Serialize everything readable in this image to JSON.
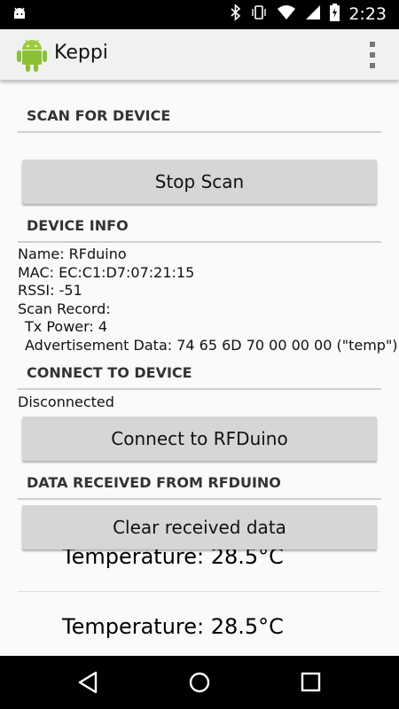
{
  "status_bar": {
    "time": "2:23"
  },
  "app": {
    "title": "Keppi"
  },
  "sections": {
    "scan_header": "SCAN FOR DEVICE",
    "device_info_header": "DEVICE INFO",
    "connect_header": "CONNECT TO DEVICE",
    "data_header": "DATA RECEIVED FROM RFDUINO"
  },
  "buttons": {
    "scan": "Stop Scan",
    "connect": "Connect to RFDuino",
    "clear": "Clear received data"
  },
  "device_info": {
    "name": "Name: RFduino",
    "mac": "MAC: EC:C1:D7:07:21:15",
    "rssi": "RSSI: -51",
    "scan_record": "Scan Record:",
    "tx_power": "Tx Power: 4",
    "advertisement": "Advertisement Data: 74 65 6D 70 00 00 00 (\"temp\")"
  },
  "connection_status": "Disconnected",
  "received": [
    "Temperature: 28.5°C",
    "Temperature: 28.5°C"
  ]
}
